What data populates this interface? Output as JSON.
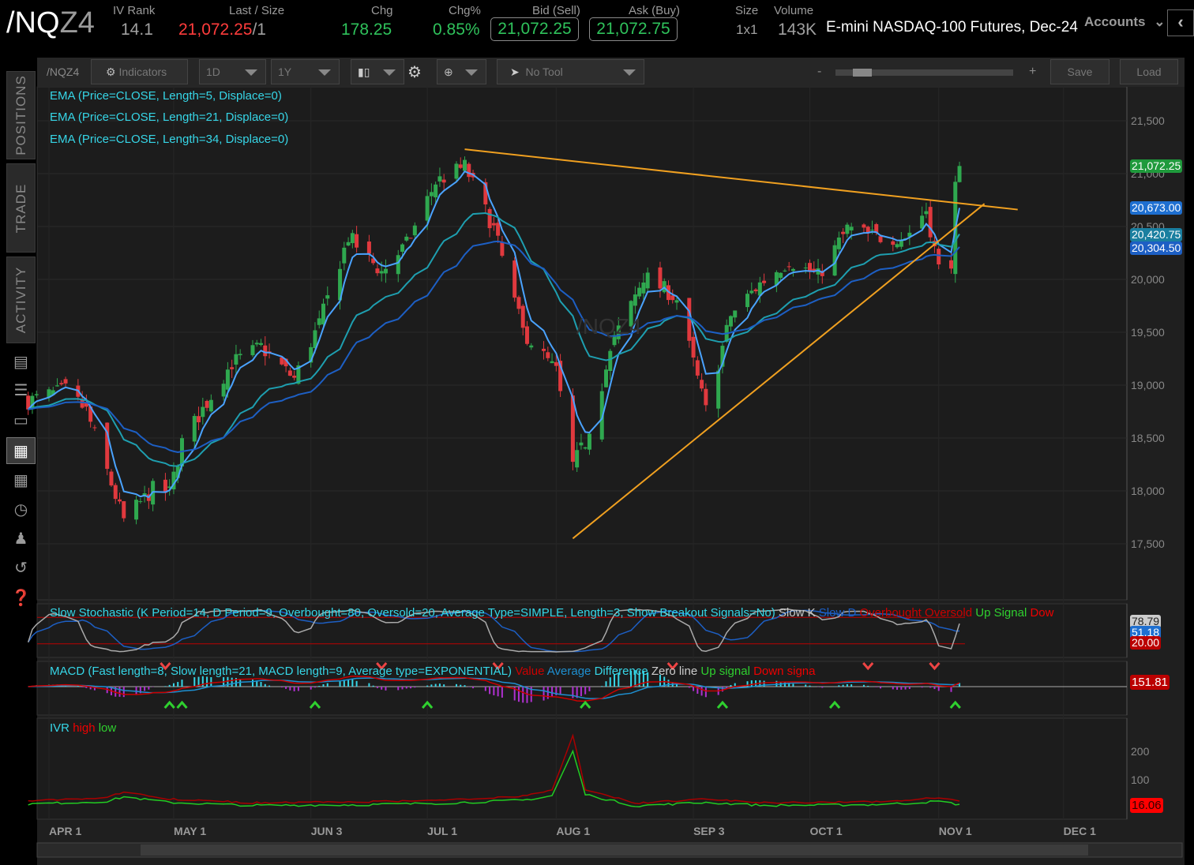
{
  "header": {
    "symbol_main": "/NQ",
    "symbol_suffix": "Z4",
    "iv_rank_label": "IV Rank",
    "iv_rank": "14.1",
    "last_size_label": "Last / Size",
    "last": "21,072.25",
    "size_suffix": "/1",
    "chg_label": "Chg",
    "chg": "178.25",
    "chgpct_label": "Chg%",
    "chgpct": "0.85%",
    "bid_label": "Bid (Sell)",
    "bid": "21,072.25",
    "ask_label": "Ask (Buy)",
    "ask": "21,072.75",
    "size_label": "Size",
    "size": "1x1",
    "volume_label": "Volume",
    "volume": "143K",
    "description": "E-mini NASDAQ-100 Futures, Dec-24",
    "accounts": "Accounts"
  },
  "toolbar": {
    "symbol": "/NQZ4",
    "indicators": "Indicators",
    "aggregation": "1D",
    "timeframe": "1Y",
    "tool": "No Tool",
    "zoom_minus": "-",
    "zoom_plus": "+",
    "save": "Save",
    "load": "Load",
    "zoom_level": 0.1
  },
  "sidebar": {
    "tabs": [
      "POSITIONS",
      "TRADE",
      "ACTIVITY"
    ],
    "icons": [
      "watchlist-icon",
      "list-icon",
      "tv-icon",
      "chart-icon",
      "grid-icon",
      "clock-icon",
      "people-icon",
      "history-icon",
      "help-icon"
    ]
  },
  "studies": {
    "ema5": "EMA (Price=CLOSE, Length=5, Displace=0)",
    "ema21": "EMA (Price=CLOSE, Length=21, Displace=0)",
    "ema34": "EMA (Price=CLOSE, Length=34, Displace=0)",
    "stoch_title": "Slow Stochastic (K Period=14, D Period=9, Overbought=80, Oversold=20, Average Type=SIMPLE, Length=3, Show Breakout Signals=No)",
    "stoch_legend": [
      "Slow K",
      "Slow D",
      "Overbought",
      "Oversold",
      "Up Signal",
      "Dow"
    ],
    "macd_title": "MACD (Fast length=8, Slow length=21, MACD length=9, Average type=EXPONENTIAL)",
    "macd_legend": [
      "Value",
      "Average",
      "Difference",
      "Zero line",
      "Up signal",
      "Down signa"
    ],
    "ivr_title": "IVR",
    "ivr_legend": [
      "high",
      "low"
    ],
    "watermark": "/NQZ4"
  },
  "badges": {
    "last": "21,072.25",
    "ema5": "20,673.00",
    "ema21": "20,420.75",
    "ema34": "20,304.50",
    "stoch_k": "78.79",
    "stoch_d": "51.18",
    "stoch_os": "20.00",
    "macd": "151.81",
    "ivr": "16.06"
  },
  "colors": {
    "up": "#2fa84f",
    "down": "#e0393e",
    "ema5": "#4aa3ff",
    "ema21": "#1e9fb0",
    "ema34": "#1d5fc4",
    "trend": "#f0a020",
    "accent_text": "#36d6e7"
  },
  "chart_data": {
    "type": "candlestick",
    "title": "/NQZ4 1D 1Y",
    "ylim": [
      17100,
      21800
    ],
    "y_ticks": [
      "21,500",
      "21,000",
      "20,500",
      "20,000",
      "19,500",
      "19,000",
      "18,500",
      "18,000",
      "17,500"
    ],
    "x_ticks": [
      "APR 1",
      "MAY 1",
      "JUN 3",
      "JUL 1",
      "AUG 1",
      "SEP 3",
      "OCT 1",
      "NOV 1",
      "DEC 1"
    ],
    "close_path": [
      [
        "03-27",
        18850
      ],
      [
        "04-01",
        18910
      ],
      [
        "04-05",
        18950
      ],
      [
        "04-10",
        18760
      ],
      [
        "04-19",
        17720
      ],
      [
        "04-26",
        18015
      ],
      [
        "04-30",
        17980
      ],
      [
        "05-03",
        18460
      ],
      [
        "05-15",
        19210
      ],
      [
        "05-22",
        19360
      ],
      [
        "05-30",
        19060
      ],
      [
        "06-05",
        19580
      ],
      [
        "06-12",
        20400
      ],
      [
        "06-20",
        20070
      ],
      [
        "06-26",
        20330
      ],
      [
        "07-03",
        20920
      ],
      [
        "07-10",
        21070
      ],
      [
        "07-17",
        20480
      ],
      [
        "07-24",
        19510
      ],
      [
        "08-01",
        19130
      ],
      [
        "08-05",
        18240
      ],
      [
        "08-08",
        18460
      ],
      [
        "08-15",
        19430
      ],
      [
        "08-22",
        20030
      ],
      [
        "08-28",
        19880
      ],
      [
        "08-30",
        19810
      ],
      [
        "09-06",
        18760
      ],
      [
        "09-12",
        19660
      ],
      [
        "09-19",
        19960
      ],
      [
        "09-26",
        20180
      ],
      [
        "10-03",
        20030
      ],
      [
        "10-10",
        20480
      ],
      [
        "10-17",
        20400
      ],
      [
        "10-24",
        20400
      ],
      [
        "10-29",
        20660
      ],
      [
        "11-01",
        20100
      ],
      [
        "11-04",
        20180
      ],
      [
        "11-05",
        20850
      ],
      [
        "11-06",
        21072.25
      ]
    ],
    "trendlines": [
      {
        "from": [
          "07-10",
          21230
        ],
        "to": [
          "11-20",
          20660
        ]
      },
      {
        "from": [
          "08-05",
          17550
        ],
        "to": [
          "11-12",
          20715
        ]
      }
    ],
    "stoch_levels": [
      80,
      20
    ],
    "macd_up_signals": [
      "04-30",
      "05-03",
      "06-04",
      "07-01",
      "08-08",
      "09-10",
      "10-07",
      "11-05"
    ],
    "macd_down_signals": [
      "04-29",
      "06-20",
      "07-18",
      "08-29",
      "10-15",
      "10-31"
    ],
    "ivr_ticks": [
      "200",
      "100"
    ],
    "ivr_path": [
      [
        "03-27",
        18
      ],
      [
        "04-15",
        30
      ],
      [
        "04-19",
        50
      ],
      [
        "04-30",
        25
      ],
      [
        "05-20",
        12
      ],
      [
        "06-15",
        15
      ],
      [
        "07-05",
        22
      ],
      [
        "07-24",
        35
      ],
      [
        "07-31",
        55
      ],
      [
        "08-05",
        250
      ],
      [
        "08-08",
        60
      ],
      [
        "08-20",
        10
      ],
      [
        "09-06",
        25
      ],
      [
        "09-20",
        12
      ],
      [
        "10-15",
        15
      ],
      [
        "10-25",
        22
      ],
      [
        "11-01",
        30
      ],
      [
        "11-06",
        16
      ]
    ]
  }
}
